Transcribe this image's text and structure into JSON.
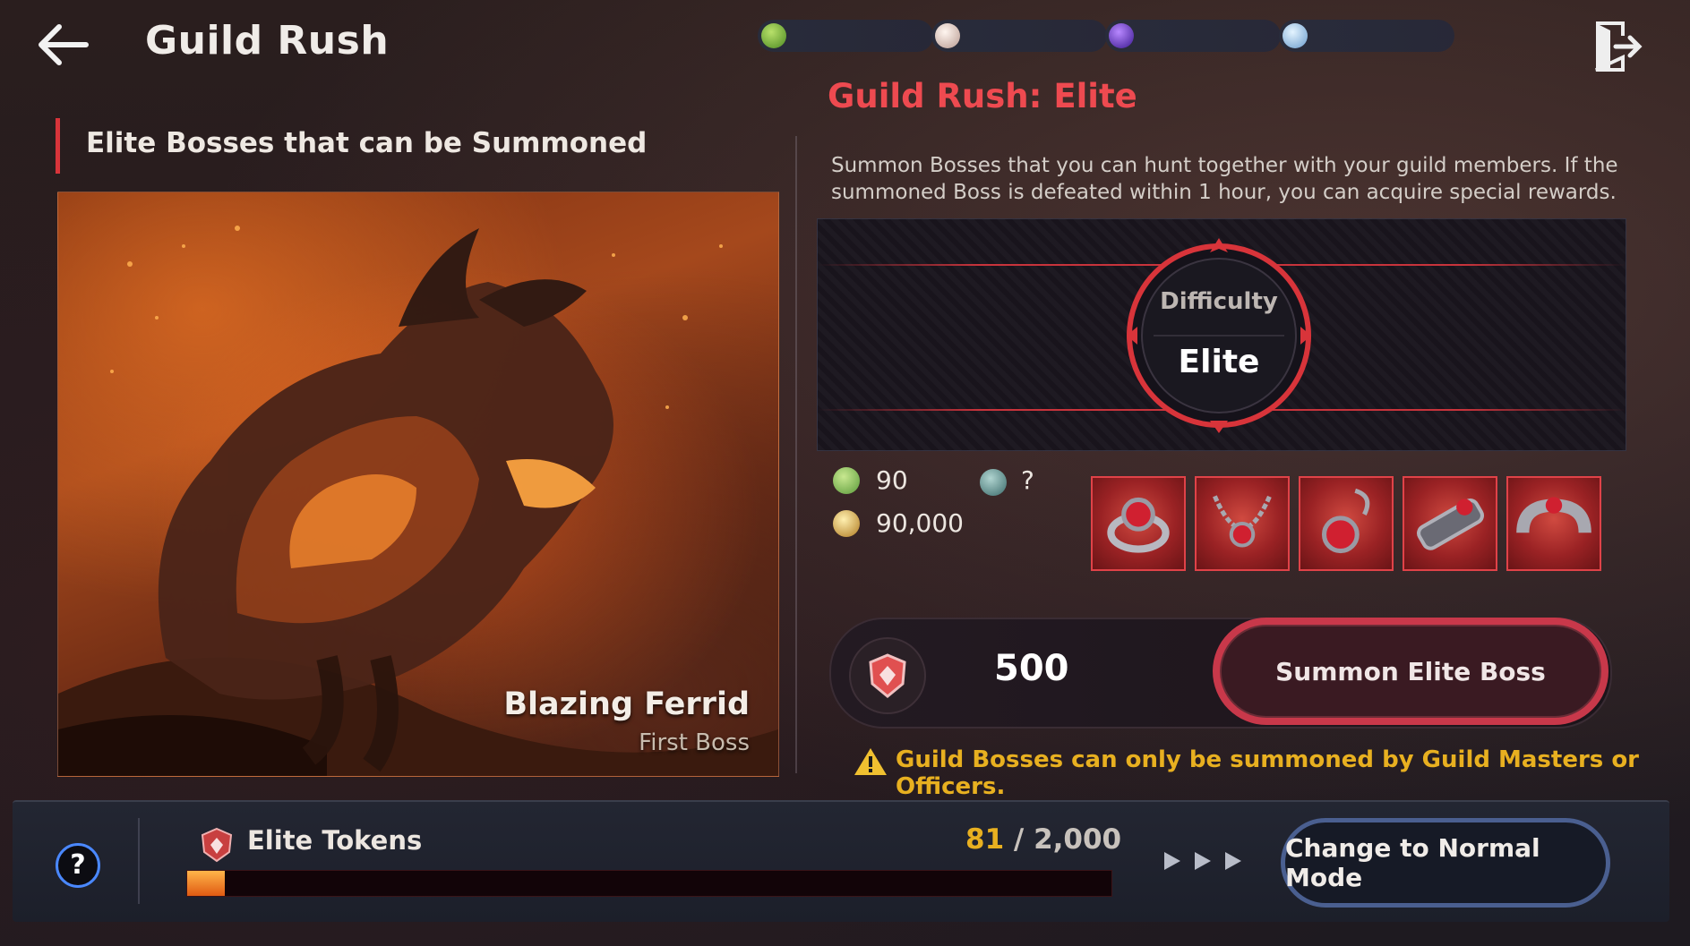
{
  "header": {
    "title": "Guild Rush",
    "currencies": [
      {
        "icon": "green-exp-orb-icon",
        "value": "",
        "color": "#6fa83a"
      },
      {
        "icon": "pearl-orb-icon",
        "value": "",
        "color": "#e8d8d0"
      },
      {
        "icon": "purple-orb-icon",
        "value": "",
        "color": "#7a3fd8"
      },
      {
        "icon": "silver-coin-icon",
        "value": "",
        "color": "#9ac8f0"
      }
    ]
  },
  "left": {
    "heading": "Elite Bosses that can be Summoned",
    "boss_name": "Blazing Ferrid",
    "boss_subtitle": "First Boss"
  },
  "right": {
    "mode_title": "Guild Rush: Elite",
    "description": "Summon Bosses that you can hunt together with your guild members. If the summoned Boss is defeated within 1 hour, you can acquire special rewards.",
    "difficulty_label": "Difficulty",
    "difficulty_value": "Elite",
    "rewards": {
      "exp": "90",
      "gold": "90,000",
      "unknown": "?"
    },
    "reward_items": [
      "ruby-ring-icon",
      "ruby-necklace-icon",
      "ruby-earring-icon",
      "ruby-bracelet-icon",
      "ruby-bangle-icon"
    ],
    "summon_cost": "500",
    "summon_button": "Summon Elite Boss",
    "warning": "Guild Bosses can only be summoned by Guild Masters or Officers."
  },
  "footer": {
    "help": "?",
    "token_label": "Elite Tokens",
    "token_have": "81",
    "token_sep": " / ",
    "token_max": "2,000",
    "token_progress": 0.0405,
    "change_mode_button": "Change to Normal Mode"
  },
  "colors": {
    "accent_red": "#ee4a50",
    "warning_yellow": "#e8b020",
    "button_blue": "#4a5f90"
  }
}
